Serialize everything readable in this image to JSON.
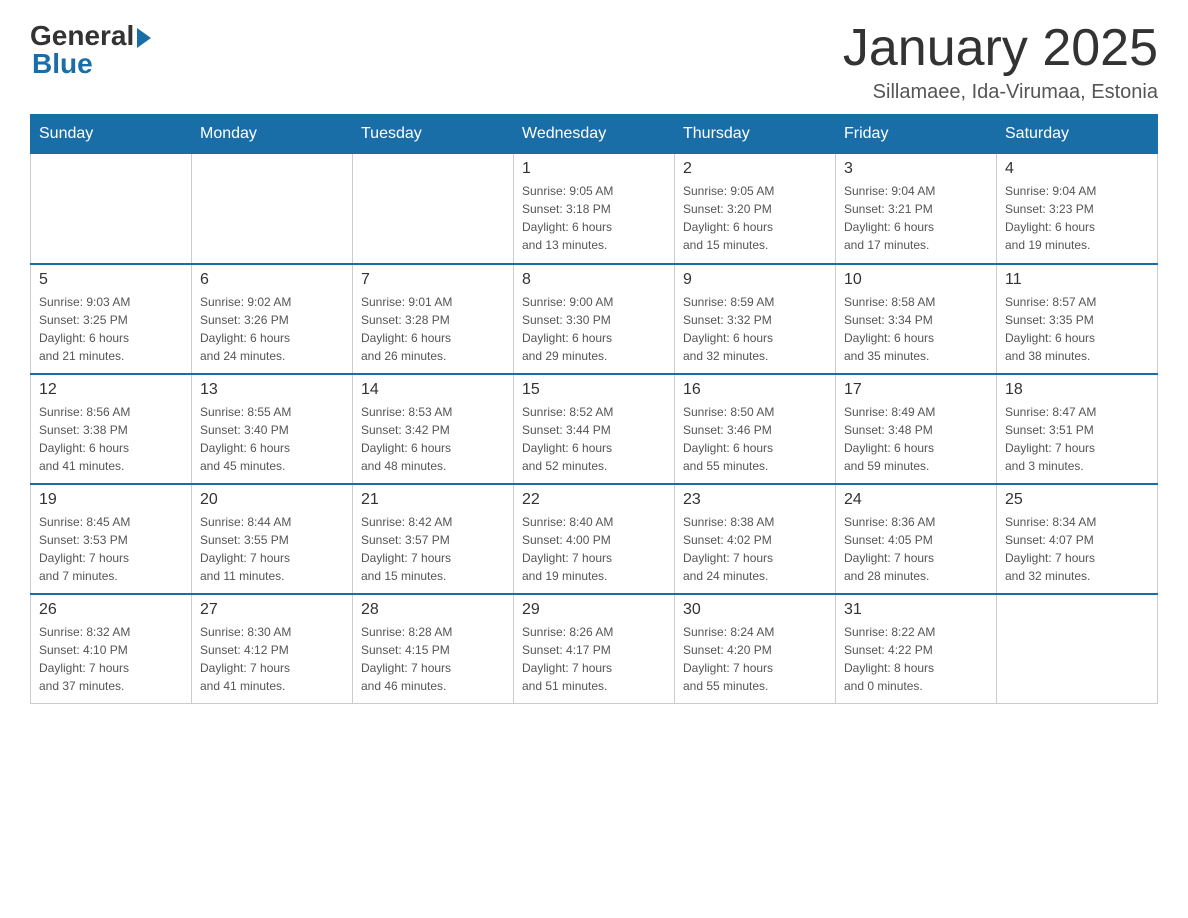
{
  "logo": {
    "general": "General",
    "blue": "Blue"
  },
  "title": "January 2025",
  "subtitle": "Sillamaee, Ida-Virumaa, Estonia",
  "days_of_week": [
    "Sunday",
    "Monday",
    "Tuesday",
    "Wednesday",
    "Thursday",
    "Friday",
    "Saturday"
  ],
  "weeks": [
    [
      {
        "day": "",
        "info": ""
      },
      {
        "day": "",
        "info": ""
      },
      {
        "day": "",
        "info": ""
      },
      {
        "day": "1",
        "info": "Sunrise: 9:05 AM\nSunset: 3:18 PM\nDaylight: 6 hours\nand 13 minutes."
      },
      {
        "day": "2",
        "info": "Sunrise: 9:05 AM\nSunset: 3:20 PM\nDaylight: 6 hours\nand 15 minutes."
      },
      {
        "day": "3",
        "info": "Sunrise: 9:04 AM\nSunset: 3:21 PM\nDaylight: 6 hours\nand 17 minutes."
      },
      {
        "day": "4",
        "info": "Sunrise: 9:04 AM\nSunset: 3:23 PM\nDaylight: 6 hours\nand 19 minutes."
      }
    ],
    [
      {
        "day": "5",
        "info": "Sunrise: 9:03 AM\nSunset: 3:25 PM\nDaylight: 6 hours\nand 21 minutes."
      },
      {
        "day": "6",
        "info": "Sunrise: 9:02 AM\nSunset: 3:26 PM\nDaylight: 6 hours\nand 24 minutes."
      },
      {
        "day": "7",
        "info": "Sunrise: 9:01 AM\nSunset: 3:28 PM\nDaylight: 6 hours\nand 26 minutes."
      },
      {
        "day": "8",
        "info": "Sunrise: 9:00 AM\nSunset: 3:30 PM\nDaylight: 6 hours\nand 29 minutes."
      },
      {
        "day": "9",
        "info": "Sunrise: 8:59 AM\nSunset: 3:32 PM\nDaylight: 6 hours\nand 32 minutes."
      },
      {
        "day": "10",
        "info": "Sunrise: 8:58 AM\nSunset: 3:34 PM\nDaylight: 6 hours\nand 35 minutes."
      },
      {
        "day": "11",
        "info": "Sunrise: 8:57 AM\nSunset: 3:35 PM\nDaylight: 6 hours\nand 38 minutes."
      }
    ],
    [
      {
        "day": "12",
        "info": "Sunrise: 8:56 AM\nSunset: 3:38 PM\nDaylight: 6 hours\nand 41 minutes."
      },
      {
        "day": "13",
        "info": "Sunrise: 8:55 AM\nSunset: 3:40 PM\nDaylight: 6 hours\nand 45 minutes."
      },
      {
        "day": "14",
        "info": "Sunrise: 8:53 AM\nSunset: 3:42 PM\nDaylight: 6 hours\nand 48 minutes."
      },
      {
        "day": "15",
        "info": "Sunrise: 8:52 AM\nSunset: 3:44 PM\nDaylight: 6 hours\nand 52 minutes."
      },
      {
        "day": "16",
        "info": "Sunrise: 8:50 AM\nSunset: 3:46 PM\nDaylight: 6 hours\nand 55 minutes."
      },
      {
        "day": "17",
        "info": "Sunrise: 8:49 AM\nSunset: 3:48 PM\nDaylight: 6 hours\nand 59 minutes."
      },
      {
        "day": "18",
        "info": "Sunrise: 8:47 AM\nSunset: 3:51 PM\nDaylight: 7 hours\nand 3 minutes."
      }
    ],
    [
      {
        "day": "19",
        "info": "Sunrise: 8:45 AM\nSunset: 3:53 PM\nDaylight: 7 hours\nand 7 minutes."
      },
      {
        "day": "20",
        "info": "Sunrise: 8:44 AM\nSunset: 3:55 PM\nDaylight: 7 hours\nand 11 minutes."
      },
      {
        "day": "21",
        "info": "Sunrise: 8:42 AM\nSunset: 3:57 PM\nDaylight: 7 hours\nand 15 minutes."
      },
      {
        "day": "22",
        "info": "Sunrise: 8:40 AM\nSunset: 4:00 PM\nDaylight: 7 hours\nand 19 minutes."
      },
      {
        "day": "23",
        "info": "Sunrise: 8:38 AM\nSunset: 4:02 PM\nDaylight: 7 hours\nand 24 minutes."
      },
      {
        "day": "24",
        "info": "Sunrise: 8:36 AM\nSunset: 4:05 PM\nDaylight: 7 hours\nand 28 minutes."
      },
      {
        "day": "25",
        "info": "Sunrise: 8:34 AM\nSunset: 4:07 PM\nDaylight: 7 hours\nand 32 minutes."
      }
    ],
    [
      {
        "day": "26",
        "info": "Sunrise: 8:32 AM\nSunset: 4:10 PM\nDaylight: 7 hours\nand 37 minutes."
      },
      {
        "day": "27",
        "info": "Sunrise: 8:30 AM\nSunset: 4:12 PM\nDaylight: 7 hours\nand 41 minutes."
      },
      {
        "day": "28",
        "info": "Sunrise: 8:28 AM\nSunset: 4:15 PM\nDaylight: 7 hours\nand 46 minutes."
      },
      {
        "day": "29",
        "info": "Sunrise: 8:26 AM\nSunset: 4:17 PM\nDaylight: 7 hours\nand 51 minutes."
      },
      {
        "day": "30",
        "info": "Sunrise: 8:24 AM\nSunset: 4:20 PM\nDaylight: 7 hours\nand 55 minutes."
      },
      {
        "day": "31",
        "info": "Sunrise: 8:22 AM\nSunset: 4:22 PM\nDaylight: 8 hours\nand 0 minutes."
      },
      {
        "day": "",
        "info": ""
      }
    ]
  ]
}
